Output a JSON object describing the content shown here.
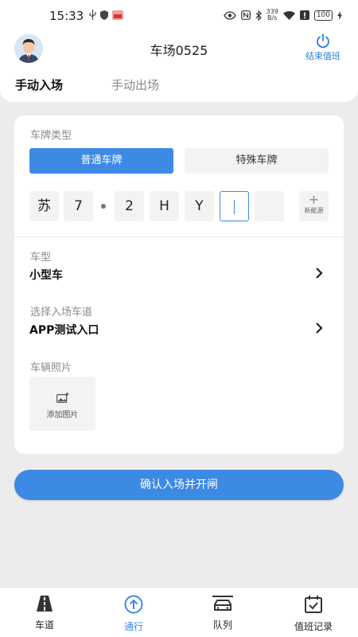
{
  "status_bar": {
    "time": "15:33",
    "net_speed_value": "339",
    "net_speed_unit": "B/s",
    "battery": "100"
  },
  "header": {
    "title": "车场0525",
    "end_shift_label": "结束值班"
  },
  "tabs": [
    {
      "label": "手动入场",
      "active": true
    },
    {
      "label": "手动出场",
      "active": false
    }
  ],
  "form": {
    "plate_type_label": "车牌类型",
    "plate_types": [
      {
        "label": "普通车牌",
        "selected": true
      },
      {
        "label": "特殊车牌",
        "selected": false
      }
    ],
    "plate_chars": [
      "苏",
      "7",
      "2",
      "H",
      "Y",
      "",
      ""
    ],
    "new_energy_label": "新能源",
    "vehicle_type_label": "车型",
    "vehicle_type_value": "小型车",
    "lane_label": "选择入场车道",
    "lane_value": "APP测试入口",
    "photo_label": "车辆照片",
    "add_photo_label": "添加图片"
  },
  "confirm_button": "确认入场并开闸",
  "bottom_nav": [
    {
      "label": "车道",
      "icon": "road-icon",
      "active": false
    },
    {
      "label": "通行",
      "icon": "upload-arrow-icon",
      "active": true
    },
    {
      "label": "队列",
      "icon": "car-queue-icon",
      "active": false
    },
    {
      "label": "值班记录",
      "icon": "calendar-check-icon",
      "active": false
    }
  ],
  "colors": {
    "accent": "#3d8ae5",
    "background": "#ececec"
  }
}
